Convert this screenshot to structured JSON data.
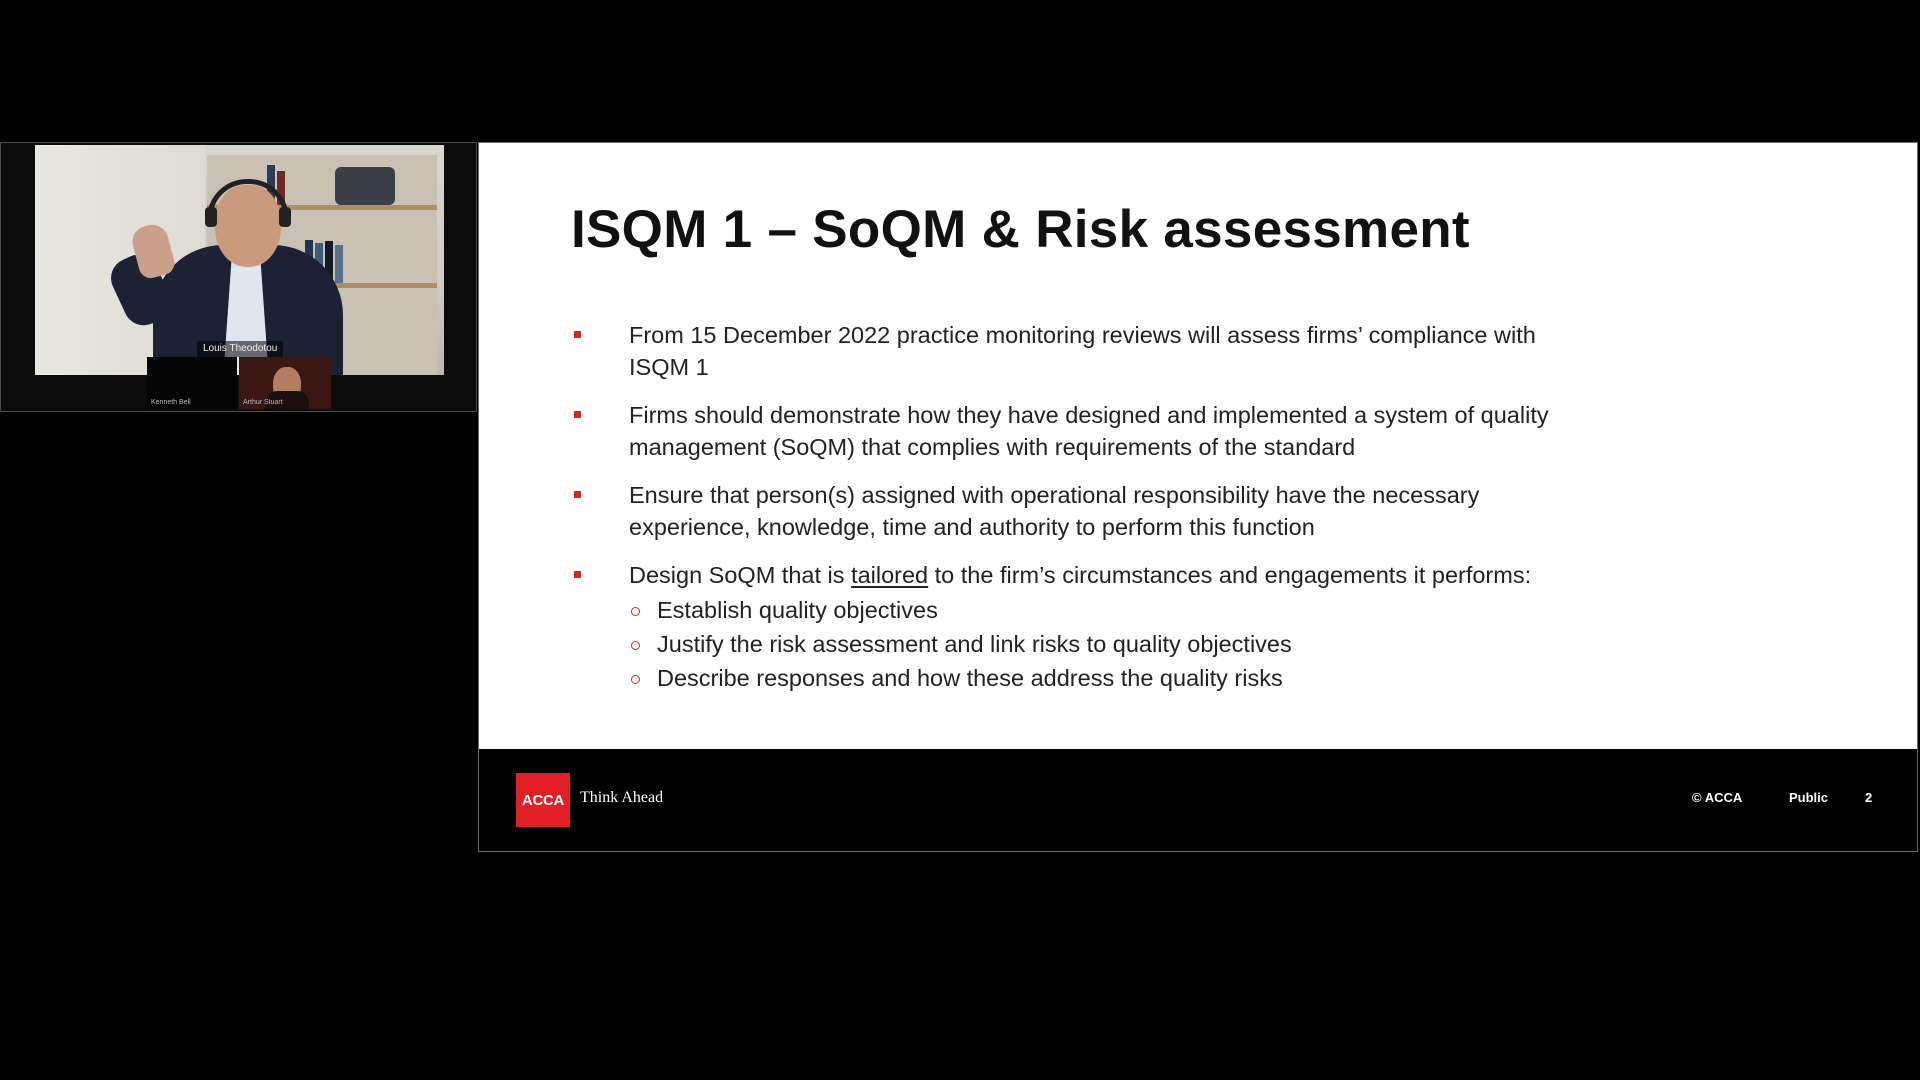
{
  "video": {
    "main_participant_name": "Louis Theodotou",
    "thumbnails": [
      {
        "label": "Kenneth Bell"
      },
      {
        "label": "Arthur Stuart"
      }
    ]
  },
  "slide": {
    "title": "ISQM 1 – SoQM & Risk assessment",
    "bullets": [
      {
        "text": "From 15 December 2022 practice monitoring reviews will assess firms’ compliance with ISQM 1"
      },
      {
        "text": "Firms should demonstrate how they have designed and implemented a system of quality management (SoQM) that complies with requirements of the standard"
      },
      {
        "text": "Ensure that person(s) assigned with operational responsibility have the necessary experience, knowledge, time and authority to perform this function"
      },
      {
        "text_before": "Design SoQM that is ",
        "text_underlined": "tailored",
        "text_after": " to the firm’s circumstances and engagements it performs:",
        "sub_bullets": [
          "Establish quality objectives",
          "Justify the risk assessment and link risks to quality objectives",
          "Describe responses and how these address the quality risks"
        ]
      }
    ],
    "footer": {
      "logo_text": "ACCA",
      "tagline": "Think Ahead",
      "copyright": "© ACCA",
      "classification": "Public",
      "page_number": "2"
    },
    "colors": {
      "accent_red": "#d52b1e",
      "logo_red": "#e21f26"
    }
  }
}
